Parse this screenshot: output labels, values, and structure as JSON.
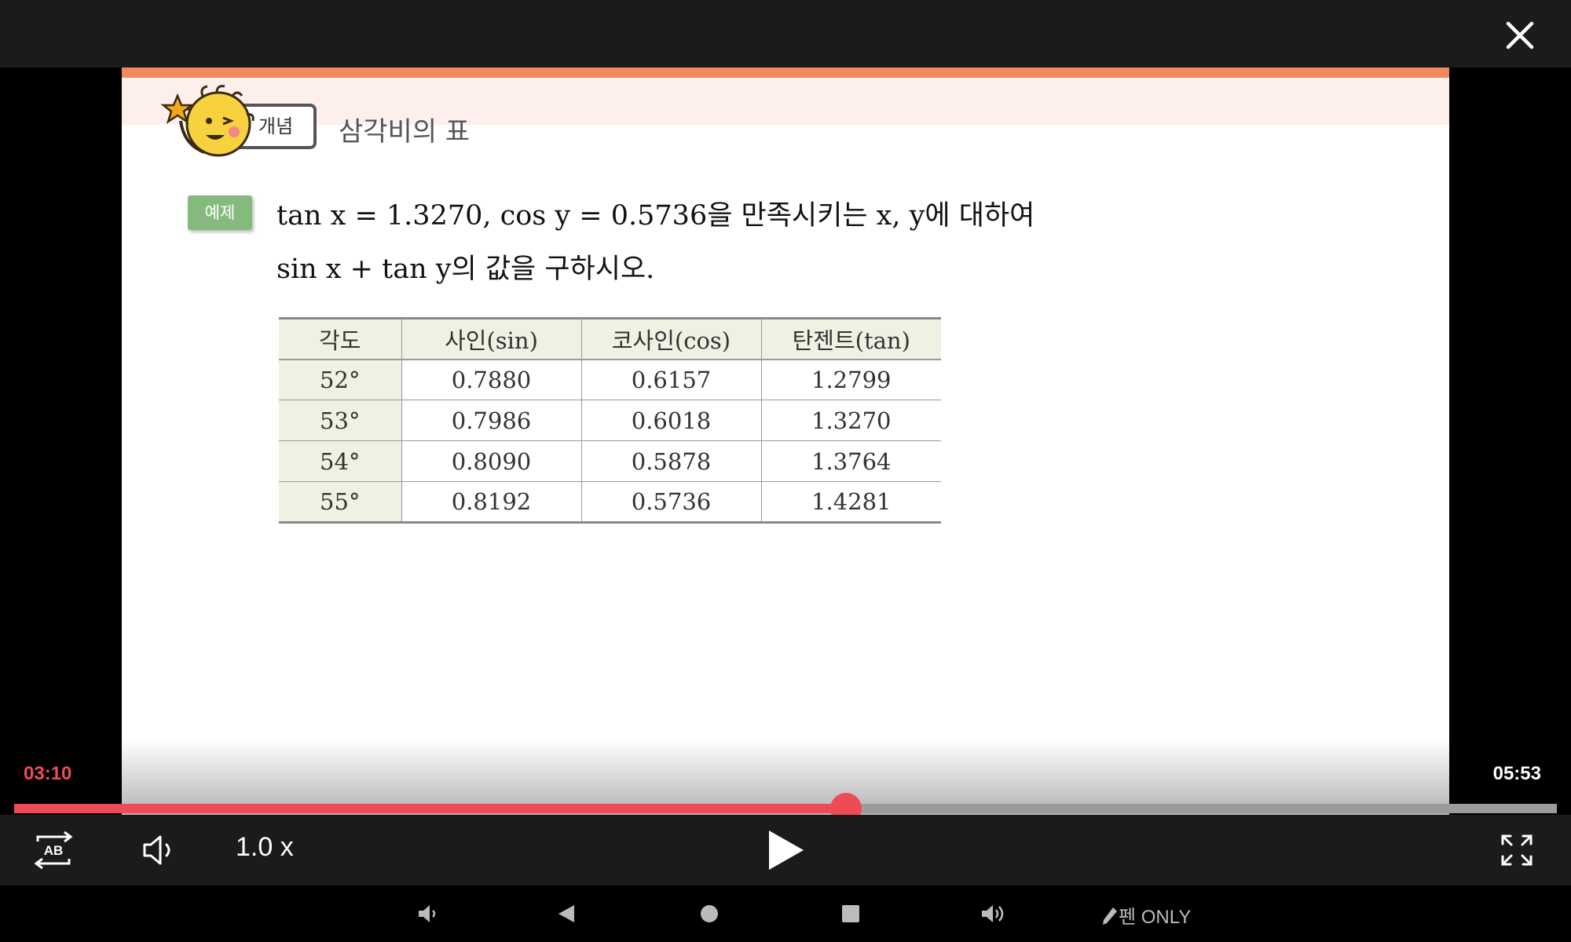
{
  "slide": {
    "concept_tag": "개념",
    "title": "삼각비의 표",
    "example_badge": "예제",
    "problem_line1": "tan x = 1.3270, cos y = 0.5736을 만족시키는 x, y에 대하여",
    "problem_line2": "sin x + tan y의 값을 구하시오.",
    "table": {
      "headers": [
        "각도",
        "사인(sin)",
        "코사인(cos)",
        "탄젠트(tan)"
      ],
      "rows": [
        [
          "52°",
          "0.7880",
          "0.6157",
          "1.2799"
        ],
        [
          "53°",
          "0.7986",
          "0.6018",
          "1.3270"
        ],
        [
          "54°",
          "0.8090",
          "0.5878",
          "1.3764"
        ],
        [
          "55°",
          "0.8192",
          "0.5736",
          "1.4281"
        ]
      ]
    }
  },
  "player": {
    "current_time": "03:10",
    "total_time": "05:53",
    "progress_fraction": 0.539,
    "speed_label": "1.0 x",
    "accent_color": "#ef4b55"
  },
  "navbar": {
    "pen_only_label": "펜 ONLY"
  },
  "icons": {
    "close": "close-icon",
    "ab_repeat": "ab-repeat-icon",
    "volume": "volume-icon",
    "play": "play-icon",
    "fullscreen": "fullscreen-icon",
    "volume_down": "volume-down-icon",
    "back": "back-icon",
    "home": "home-icon",
    "recents": "recents-icon",
    "volume_up": "volume-up-icon",
    "pen": "pen-icon"
  }
}
